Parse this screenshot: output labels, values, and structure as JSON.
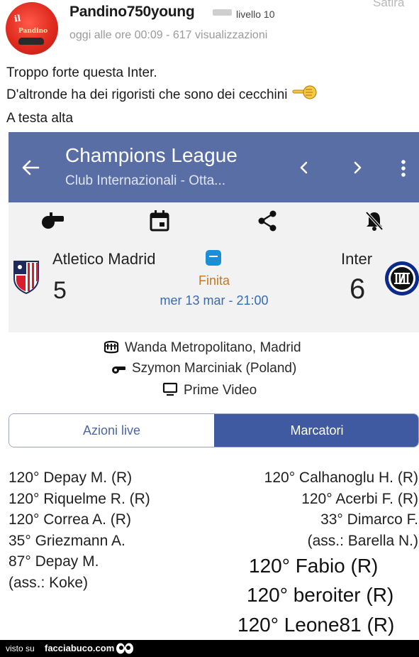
{
  "post": {
    "username": "Pandino750young",
    "level": "livello 10",
    "category": "Satira",
    "meta": "oggi alle ore 00:09 - 617 visualizzazioni",
    "avatar": {
      "top_text": "il",
      "mid_text": "Pandino",
      "color": "#e02b1f"
    },
    "lines": [
      "Troppo forte questa Inter.",
      "D'altronde ha dei rigoristi che sono dei cecchini",
      "A testa alta"
    ],
    "inline_icon": "pointing-finger-emoji"
  },
  "app": {
    "header": {
      "title": "Champions League",
      "subtitle": "Club Internazionali - Otta...",
      "color": "#5a6ea6",
      "icons": [
        "back-arrow-icon",
        "chevron-left-icon",
        "chevron-right-icon",
        "more-vert-icon"
      ]
    },
    "actions": [
      "whistle-icon",
      "calendar-icon",
      "share-icon",
      "notifications-off-icon"
    ],
    "match": {
      "home": {
        "name": "Atletico Madrid",
        "score": "5"
      },
      "away": {
        "name": "Inter",
        "score": "6"
      },
      "status": "Finita",
      "datetime": "mer 13 mar - 21:00",
      "broadcaster_icon": "prime-video-badge"
    },
    "info": {
      "stadium": "Wanda Metropolitano, Madrid",
      "referee": "Szymon Marciniak (Poland)",
      "tv": "Prime Video"
    },
    "tabs": [
      {
        "label": "Azioni live",
        "active": false
      },
      {
        "label": "Marcatori",
        "active": true
      }
    ],
    "scorers": {
      "home": [
        "120° Depay M. (R)",
        "120° Riquelme R. (R)",
        "120° Correa A. (R)",
        "35° Griezmann A.",
        "87° Depay M.",
        "(ass.: Koke)"
      ],
      "away": [
        "120° Calhanoglu H. (R)",
        "120° Acerbi F. (R)",
        "33° Dimarco F.",
        "(ass.: Barella N.)"
      ],
      "added": [
        "120° Fabio (R)",
        "120° beroiter (R)",
        "120° Leone81 (R)"
      ]
    }
  },
  "footer": {
    "prefix": "visto su",
    "site": "facciabuco.com"
  }
}
